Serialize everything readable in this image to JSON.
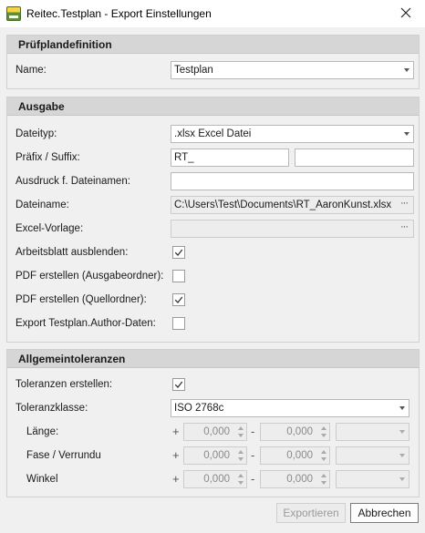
{
  "window": {
    "title": "Reitec.Testplan - Export Einstellungen"
  },
  "pruefplan": {
    "header": "Prüfplandefinition",
    "name_label": "Name:",
    "name_value": "Testplan"
  },
  "ausgabe": {
    "header": "Ausgabe",
    "dateityp_label": "Dateityp:",
    "dateityp_value": ".xlsx Excel Datei",
    "praefix_label": "Präfix / Suffix:",
    "praefix_value": "RT_",
    "suffix_value": "",
    "ausdruck_label": "Ausdruck f. Dateinamen:",
    "ausdruck_value": "",
    "dateiname_label": "Dateiname:",
    "dateiname_value": "C:\\Users\\Test\\Documents\\RT_AaronKunst.xlsx",
    "vorlage_label": "Excel-Vorlage:",
    "vorlage_value": "",
    "arbeitsblatt_label": "Arbeitsblatt ausblenden:",
    "arbeitsblatt_checked": true,
    "pdf_ausgabe_label": "PDF erstellen (Ausgabeordner):",
    "pdf_ausgabe_checked": false,
    "pdf_quell_label": "PDF erstellen (Quellordner):",
    "pdf_quell_checked": true,
    "author_label": "Export Testplan.Author-Daten:",
    "author_checked": false
  },
  "toleranzen": {
    "header": "Allgemeintoleranzen",
    "erstellen_label": "Toleranzen erstellen:",
    "erstellen_checked": true,
    "klasse_label": "Toleranzklasse:",
    "klasse_value": "ISO 2768c",
    "rows": [
      {
        "label": "Länge:",
        "plus": "+",
        "plus_value": "0,000",
        "minus": "-",
        "minus_value": "0,000"
      },
      {
        "label": "Fase / Verrundu",
        "plus": "+",
        "plus_value": "0,000",
        "minus": "-",
        "minus_value": "0,000"
      },
      {
        "label": "Winkel",
        "plus": "+",
        "plus_value": "0,000",
        "minus": "-",
        "minus_value": "0,000"
      }
    ]
  },
  "buttons": {
    "export": "Exportieren",
    "cancel": "Abbrechen"
  },
  "icons": {
    "app": "app-icon",
    "close": "close-icon",
    "browse": "ellipsis-icon",
    "dropdown": "chevron-down-icon",
    "check": "checkmark-icon"
  }
}
